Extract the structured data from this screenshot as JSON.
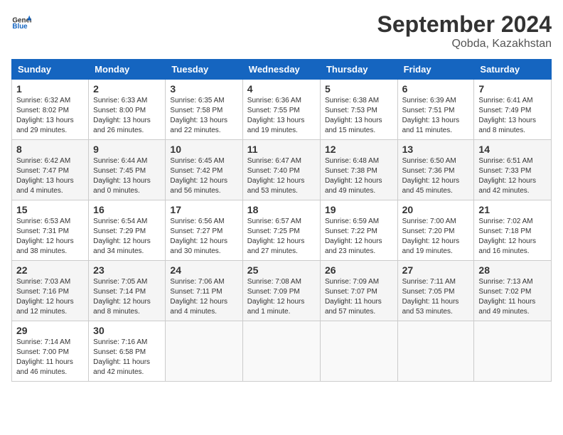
{
  "header": {
    "logo_general": "General",
    "logo_blue": "Blue",
    "month_year": "September 2024",
    "location": "Qobda, Kazakhstan"
  },
  "weekdays": [
    "Sunday",
    "Monday",
    "Tuesday",
    "Wednesday",
    "Thursday",
    "Friday",
    "Saturday"
  ],
  "weeks": [
    [
      {
        "day": "1",
        "info": "Sunrise: 6:32 AM\nSunset: 8:02 PM\nDaylight: 13 hours\nand 29 minutes."
      },
      {
        "day": "2",
        "info": "Sunrise: 6:33 AM\nSunset: 8:00 PM\nDaylight: 13 hours\nand 26 minutes."
      },
      {
        "day": "3",
        "info": "Sunrise: 6:35 AM\nSunset: 7:58 PM\nDaylight: 13 hours\nand 22 minutes."
      },
      {
        "day": "4",
        "info": "Sunrise: 6:36 AM\nSunset: 7:55 PM\nDaylight: 13 hours\nand 19 minutes."
      },
      {
        "day": "5",
        "info": "Sunrise: 6:38 AM\nSunset: 7:53 PM\nDaylight: 13 hours\nand 15 minutes."
      },
      {
        "day": "6",
        "info": "Sunrise: 6:39 AM\nSunset: 7:51 PM\nDaylight: 13 hours\nand 11 minutes."
      },
      {
        "day": "7",
        "info": "Sunrise: 6:41 AM\nSunset: 7:49 PM\nDaylight: 13 hours\nand 8 minutes."
      }
    ],
    [
      {
        "day": "8",
        "info": "Sunrise: 6:42 AM\nSunset: 7:47 PM\nDaylight: 13 hours\nand 4 minutes."
      },
      {
        "day": "9",
        "info": "Sunrise: 6:44 AM\nSunset: 7:45 PM\nDaylight: 13 hours\nand 0 minutes."
      },
      {
        "day": "10",
        "info": "Sunrise: 6:45 AM\nSunset: 7:42 PM\nDaylight: 12 hours\nand 56 minutes."
      },
      {
        "day": "11",
        "info": "Sunrise: 6:47 AM\nSunset: 7:40 PM\nDaylight: 12 hours\nand 53 minutes."
      },
      {
        "day": "12",
        "info": "Sunrise: 6:48 AM\nSunset: 7:38 PM\nDaylight: 12 hours\nand 49 minutes."
      },
      {
        "day": "13",
        "info": "Sunrise: 6:50 AM\nSunset: 7:36 PM\nDaylight: 12 hours\nand 45 minutes."
      },
      {
        "day": "14",
        "info": "Sunrise: 6:51 AM\nSunset: 7:33 PM\nDaylight: 12 hours\nand 42 minutes."
      }
    ],
    [
      {
        "day": "15",
        "info": "Sunrise: 6:53 AM\nSunset: 7:31 PM\nDaylight: 12 hours\nand 38 minutes."
      },
      {
        "day": "16",
        "info": "Sunrise: 6:54 AM\nSunset: 7:29 PM\nDaylight: 12 hours\nand 34 minutes."
      },
      {
        "day": "17",
        "info": "Sunrise: 6:56 AM\nSunset: 7:27 PM\nDaylight: 12 hours\nand 30 minutes."
      },
      {
        "day": "18",
        "info": "Sunrise: 6:57 AM\nSunset: 7:25 PM\nDaylight: 12 hours\nand 27 minutes."
      },
      {
        "day": "19",
        "info": "Sunrise: 6:59 AM\nSunset: 7:22 PM\nDaylight: 12 hours\nand 23 minutes."
      },
      {
        "day": "20",
        "info": "Sunrise: 7:00 AM\nSunset: 7:20 PM\nDaylight: 12 hours\nand 19 minutes."
      },
      {
        "day": "21",
        "info": "Sunrise: 7:02 AM\nSunset: 7:18 PM\nDaylight: 12 hours\nand 16 minutes."
      }
    ],
    [
      {
        "day": "22",
        "info": "Sunrise: 7:03 AM\nSunset: 7:16 PM\nDaylight: 12 hours\nand 12 minutes."
      },
      {
        "day": "23",
        "info": "Sunrise: 7:05 AM\nSunset: 7:14 PM\nDaylight: 12 hours\nand 8 minutes."
      },
      {
        "day": "24",
        "info": "Sunrise: 7:06 AM\nSunset: 7:11 PM\nDaylight: 12 hours\nand 4 minutes."
      },
      {
        "day": "25",
        "info": "Sunrise: 7:08 AM\nSunset: 7:09 PM\nDaylight: 12 hours\nand 1 minute."
      },
      {
        "day": "26",
        "info": "Sunrise: 7:09 AM\nSunset: 7:07 PM\nDaylight: 11 hours\nand 57 minutes."
      },
      {
        "day": "27",
        "info": "Sunrise: 7:11 AM\nSunset: 7:05 PM\nDaylight: 11 hours\nand 53 minutes."
      },
      {
        "day": "28",
        "info": "Sunrise: 7:13 AM\nSunset: 7:02 PM\nDaylight: 11 hours\nand 49 minutes."
      }
    ],
    [
      {
        "day": "29",
        "info": "Sunrise: 7:14 AM\nSunset: 7:00 PM\nDaylight: 11 hours\nand 46 minutes."
      },
      {
        "day": "30",
        "info": "Sunrise: 7:16 AM\nSunset: 6:58 PM\nDaylight: 11 hours\nand 42 minutes."
      },
      null,
      null,
      null,
      null,
      null
    ]
  ]
}
